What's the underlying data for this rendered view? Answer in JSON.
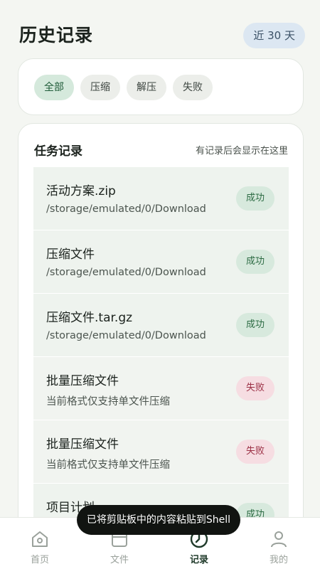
{
  "header": {
    "title": "历史记录",
    "range_badge": "近 30 天"
  },
  "filters": [
    {
      "label": "全部",
      "active": true
    },
    {
      "label": "压缩",
      "active": false
    },
    {
      "label": "解压",
      "active": false
    },
    {
      "label": "失败",
      "active": false
    }
  ],
  "tasks": {
    "title": "任务记录",
    "hint": "有记录后会显示在这里",
    "items": [
      {
        "name": "活动方案.zip",
        "sub": "/storage/emulated/0/Download",
        "status": "成功",
        "state": "ok"
      },
      {
        "name": "压缩文件",
        "sub": "/storage/emulated/0/Download",
        "status": "成功",
        "state": "ok"
      },
      {
        "name": "压缩文件.tar.gz",
        "sub": "/storage/emulated/0/Download",
        "status": "成功",
        "state": "ok"
      },
      {
        "name": "批量压缩文件",
        "sub": "当前格式仅支持单文件压缩",
        "status": "失败",
        "state": "bad"
      },
      {
        "name": "批量压缩文件",
        "sub": "当前格式仅支持单文件压缩",
        "status": "失败",
        "state": "bad"
      },
      {
        "name": "项目计划",
        "sub": "",
        "status": "成功",
        "state": "ok"
      }
    ]
  },
  "nav": [
    {
      "label": "首页",
      "icon": "home-icon",
      "active": false
    },
    {
      "label": "文件",
      "icon": "folder-icon",
      "active": false
    },
    {
      "label": "记录",
      "icon": "history-clock-icon",
      "active": true
    },
    {
      "label": "我的",
      "icon": "user-icon",
      "active": false
    }
  ],
  "toast": "已将剪贴板中的内容粘贴到Shell",
  "colors": {
    "accent_green": "#d5e9dc",
    "success_text": "#2c6b43",
    "fail_bg": "#f6dde2",
    "fail_text": "#9b2f44"
  }
}
